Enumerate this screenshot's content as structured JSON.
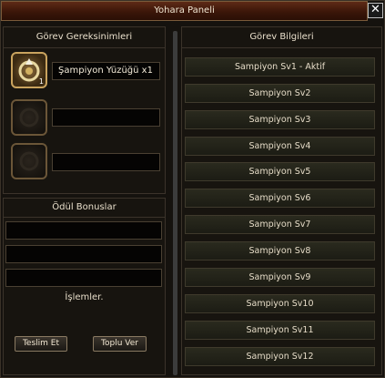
{
  "window": {
    "title": "Yohara Paneli",
    "close_glyph": "✕"
  },
  "requirements": {
    "header": "Görev Gereksinimleri",
    "slots": [
      {
        "icon": "championship-ring-icon",
        "label": "Şampiyon Yüzüğü x1",
        "count": "1"
      },
      {
        "icon": "empty-slot-icon",
        "label": ""
      },
      {
        "icon": "empty-slot-icon",
        "label": ""
      }
    ]
  },
  "rewards": {
    "header": "Ödül Bonuslar",
    "fields": [
      "",
      "",
      ""
    ]
  },
  "actions": {
    "header": "İşlemler.",
    "submit_label": "Teslim Et",
    "bulk_label": "Toplu Ver"
  },
  "info": {
    "header": "Görev Bilgileri",
    "items": [
      "Sampiyon Sv1 - Aktif",
      "Sampiyon Sv2",
      "Sampiyon Sv3",
      "Sampiyon Sv4",
      "Sampiyon Sv5",
      "Sampiyon Sv6",
      "Sampiyon Sv7",
      "Sampiyon Sv8",
      "Sampiyon Sv9",
      "Sampiyon Sv10",
      "Sampiyon Sv11",
      "Sampiyon Sv12"
    ]
  }
}
